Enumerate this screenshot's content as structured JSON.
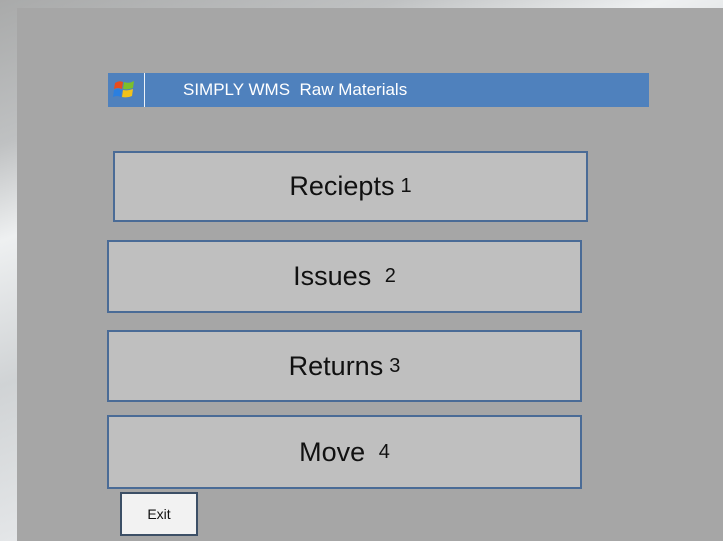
{
  "app": {
    "title": "SIMPLY WMS  Raw Materials",
    "logo_icon": "windows-flag-icon",
    "title_bar_color": "#4f81bd"
  },
  "menu": {
    "items": [
      {
        "label": "Reciepts",
        "number": "1"
      },
      {
        "label": "Issues ",
        "number": "2"
      },
      {
        "label": "Returns",
        "number": "3"
      },
      {
        "label": "Move ",
        "number": "4"
      }
    ]
  },
  "footer": {
    "exit_label": "Exit"
  }
}
